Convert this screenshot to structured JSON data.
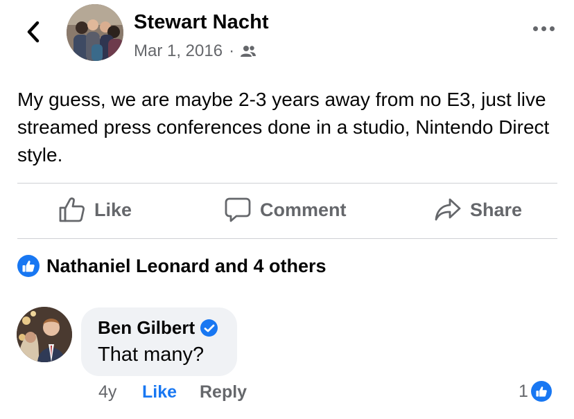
{
  "post": {
    "author": "Stewart Nacht",
    "date": "Mar 1, 2016",
    "separator": "·",
    "audience_icon": "friends-icon",
    "text": "My guess, we are maybe 2-3 years away from no E3, just live streamed press conferences done in a studio, Nintendo Direct style."
  },
  "actions": {
    "like": "Like",
    "comment": "Comment",
    "share": "Share"
  },
  "reactions": {
    "icon": "like-reaction-icon",
    "summary": "Nathaniel Leonard and 4 others"
  },
  "comment": {
    "author": "Ben Gilbert",
    "verified": true,
    "text": "That many?",
    "time": "4y",
    "like_label": "Like",
    "reply_label": "Reply",
    "reaction_count": "1"
  },
  "colors": {
    "accent": "#1877f2",
    "secondary_text": "#65676b",
    "bubble": "#f0f2f5",
    "divider": "#ced0d4"
  }
}
